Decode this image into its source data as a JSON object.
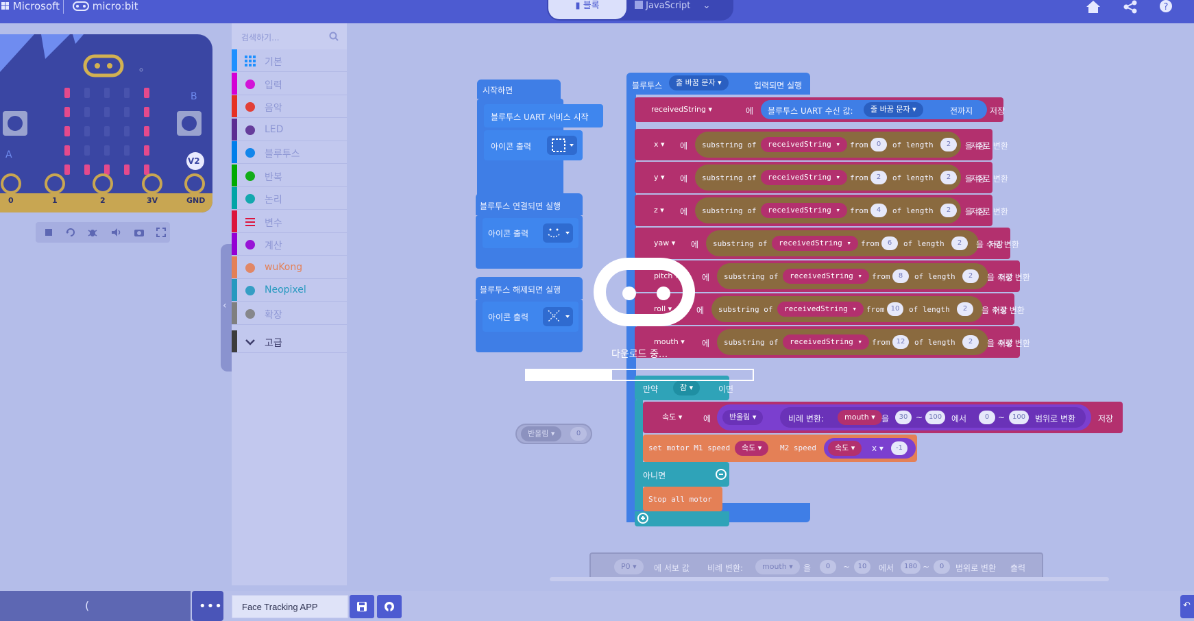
{
  "header": {
    "microsoft": "Microsoft",
    "microbit": "micro:bit",
    "mode_blocks": "블록",
    "mode_javascript": "JavaScript"
  },
  "simulator": {
    "button_a": "A",
    "button_b": "B",
    "version_badge": "V2",
    "pins": [
      "0",
      "1",
      "2",
      "3V",
      "GND"
    ]
  },
  "toolbox": {
    "search_placeholder": "검색하기...",
    "categories": [
      {
        "label": "기본",
        "color": "#1e90ff"
      },
      {
        "label": "입력",
        "color": "#d400d4"
      },
      {
        "label": "음악",
        "color": "#e63022"
      },
      {
        "label": "LED",
        "color": "#5c2d91"
      },
      {
        "label": "블루투스",
        "color": "#007eea"
      },
      {
        "label": "반복",
        "color": "#00aa00"
      },
      {
        "label": "논리",
        "color": "#00a4a6"
      },
      {
        "label": "변수",
        "color": "#dc143c"
      },
      {
        "label": "계산",
        "color": "#9400d3"
      },
      {
        "label": "wuKong",
        "color": "#e48056"
      },
      {
        "label": "Neopixel",
        "color": "#2699bf"
      },
      {
        "label": "확장",
        "color": "#7f7f7f"
      },
      {
        "label": "고급",
        "color": "#3c3c3c"
      }
    ]
  },
  "workspace": {
    "on_start": {
      "hat": "시작하면",
      "line1": "블루투스 UART 서비스 시작",
      "line2": "아이콘 출력"
    },
    "on_connected": {
      "hat": "블루투스 연결되면 실행",
      "line": "아이콘 출력"
    },
    "on_disconnected": {
      "hat": "블루투스 해제되면 실행",
      "line": "아이콘 출력"
    },
    "stray_round": {
      "label": "반올림",
      "value": "0"
    },
    "main": {
      "hat_prefix": "블루투스",
      "hat_dropdown": "줄 바꿈 문자",
      "hat_suffix": "입력되면 실행",
      "recv_var": "receivedString",
      "eul": "에",
      "recv_block": "블루투스 UART 수신 값:",
      "recv_dropdown": "줄 바꿈 문자",
      "recv_until": "전까지",
      "store": "저장",
      "substring": "substring of",
      "from": "from",
      "of_length": "of length",
      "to_number": "을 수로 변환",
      "rows": [
        {
          "var": "x",
          "from": "0",
          "len": "2"
        },
        {
          "var": "y",
          "from": "2",
          "len": "2"
        },
        {
          "var": "z",
          "from": "4",
          "len": "2"
        },
        {
          "var": "yaw",
          "from": "6",
          "len": "2"
        },
        {
          "var": "pitch",
          "from": "8",
          "len": "2"
        },
        {
          "var": "roll",
          "from": "10",
          "len": "2"
        },
        {
          "var": "mouth",
          "from": "12",
          "len": "2"
        }
      ],
      "if_label": "만약",
      "if_cond": "참",
      "if_then": "이면",
      "speed_var": "속도",
      "round": "반올림",
      "map": "비례 변환:",
      "map_var": "mouth",
      "map_eul": "을",
      "map_from_low": "30",
      "map_from_high": "100",
      "map_to_word": "에서",
      "map_to_low": "0",
      "map_to_high": "100",
      "map_suffix": "범위로 변환",
      "tilde": "~",
      "motor_label": "set motor M1 speed",
      "motor_m2": "M2 speed",
      "times": "x",
      "neg_one": "-1",
      "else_label": "아니면",
      "stop_all": "Stop all motor"
    },
    "servo": {
      "pin": "P0",
      "text1": "에 서보 값",
      "map": "비례 변환:",
      "map_var": "mouth",
      "eul": "을",
      "a": "0",
      "b": "10",
      "word": "에서",
      "c": "180",
      "d": "0",
      "suffix": "범위로 변환",
      "out": "출력"
    }
  },
  "loading": {
    "text": "다운로드 중...",
    "progress": 0.38
  },
  "bottom": {
    "project_name": "Face Tracking APP",
    "collapse": "("
  }
}
